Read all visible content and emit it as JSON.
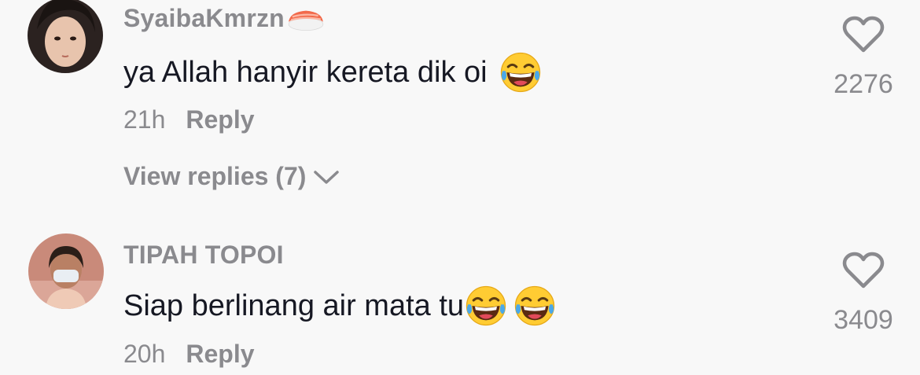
{
  "comments": [
    {
      "username": "SyaibaKmrzn",
      "username_emoji": "sushi-icon",
      "text": "ya Allah hanyir kereta dik oi",
      "text_emojis": [
        "laughing-tears-icon"
      ],
      "time": "21h",
      "reply_label": "Reply",
      "view_replies_label": "View replies (7)",
      "like_count": "2276"
    },
    {
      "username": "TIPAH TOPOI",
      "text": "Siap berlinang air mata tu",
      "text_emojis": [
        "laughing-tears-icon",
        "laughing-tears-icon"
      ],
      "time": "20h",
      "reply_label": "Reply",
      "like_count": "3409"
    }
  ],
  "colors": {
    "background": "#f8f8f8",
    "text_primary": "#161823",
    "text_secondary": "#8a8a8e"
  }
}
